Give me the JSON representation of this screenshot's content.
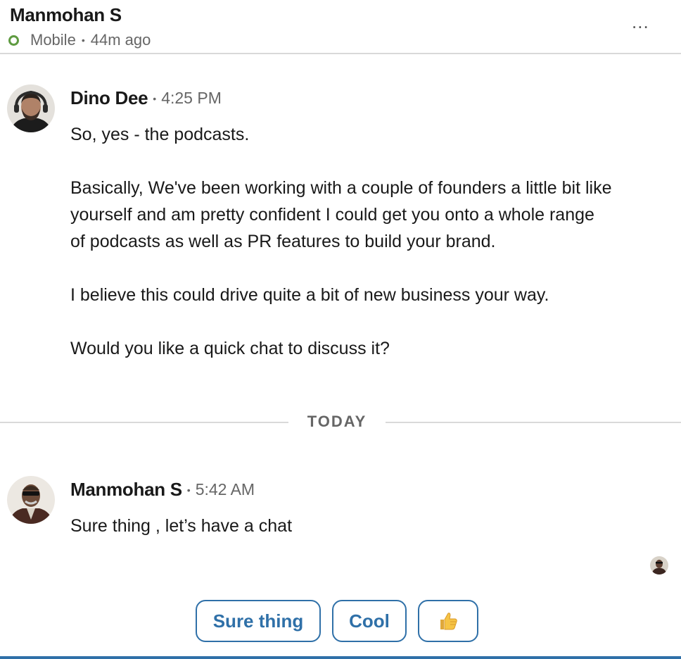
{
  "header": {
    "contact_name": "Manmohan S",
    "presence": "Mobile",
    "last_seen": "44m ago",
    "presence_color": "#5f9b41",
    "more_glyph": "..."
  },
  "messages": [
    {
      "sender": "Dino Dee",
      "time": "4:25 PM",
      "paragraphs": [
        [
          "So, yes - the podcasts."
        ],
        [
          "Basically, We've been working with a couple of founders a little bit like",
          "yourself and am pretty confident I could get you onto a whole range",
          "of podcasts as well as PR features to build your brand."
        ],
        [
          "I believe this could drive quite a bit of new business your way."
        ],
        [
          "Would you like a quick chat to discuss it?"
        ]
      ]
    },
    {
      "sender": "Manmohan S",
      "time": "5:42 AM",
      "paragraphs": [
        [
          "Sure thing , let’s have a chat"
        ]
      ]
    }
  ],
  "divider_label": "TODAY",
  "quick_replies": [
    "Sure thing",
    "Cool",
    "👍"
  ],
  "colors": {
    "accent": "#2f70a8",
    "divider": "#d9d9d9",
    "muted_text": "#666666"
  }
}
